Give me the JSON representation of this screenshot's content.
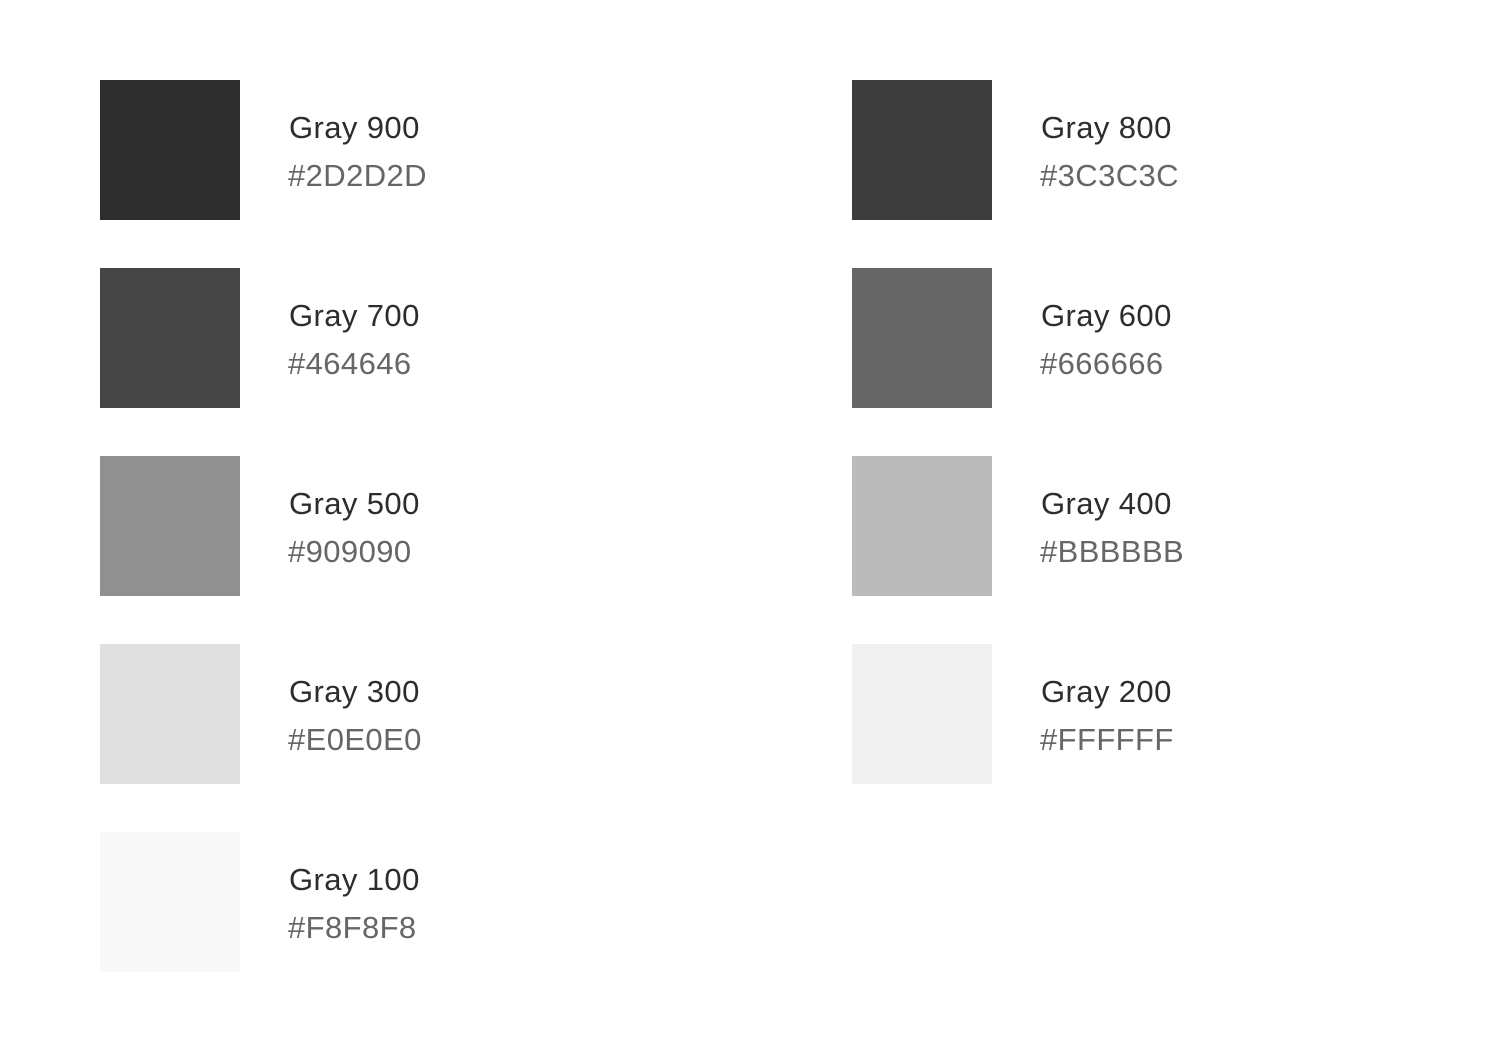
{
  "swatches": [
    {
      "name": "Gray 900",
      "hex": "#2D2D2D",
      "color": "#2D2D2D"
    },
    {
      "name": "Gray 800",
      "hex": "#3C3C3C",
      "color": "#3C3C3C"
    },
    {
      "name": "Gray 700",
      "hex": "#464646",
      "color": "#464646"
    },
    {
      "name": "Gray 600",
      "hex": "#666666",
      "color": "#666666"
    },
    {
      "name": "Gray 500",
      "hex": "#909090",
      "color": "#909090"
    },
    {
      "name": "Gray 400",
      "hex": "#BBBBBB",
      "color": "#BBBBBB"
    },
    {
      "name": "Gray 300",
      "hex": "#E0E0E0",
      "color": "#E0E0E0"
    },
    {
      "name": "Gray 200",
      "hex": "#FFFFFF",
      "color": "#F0F0F0"
    },
    {
      "name": "Gray 100",
      "hex": "#F8F8F8",
      "color": "#F8F8F8"
    }
  ]
}
